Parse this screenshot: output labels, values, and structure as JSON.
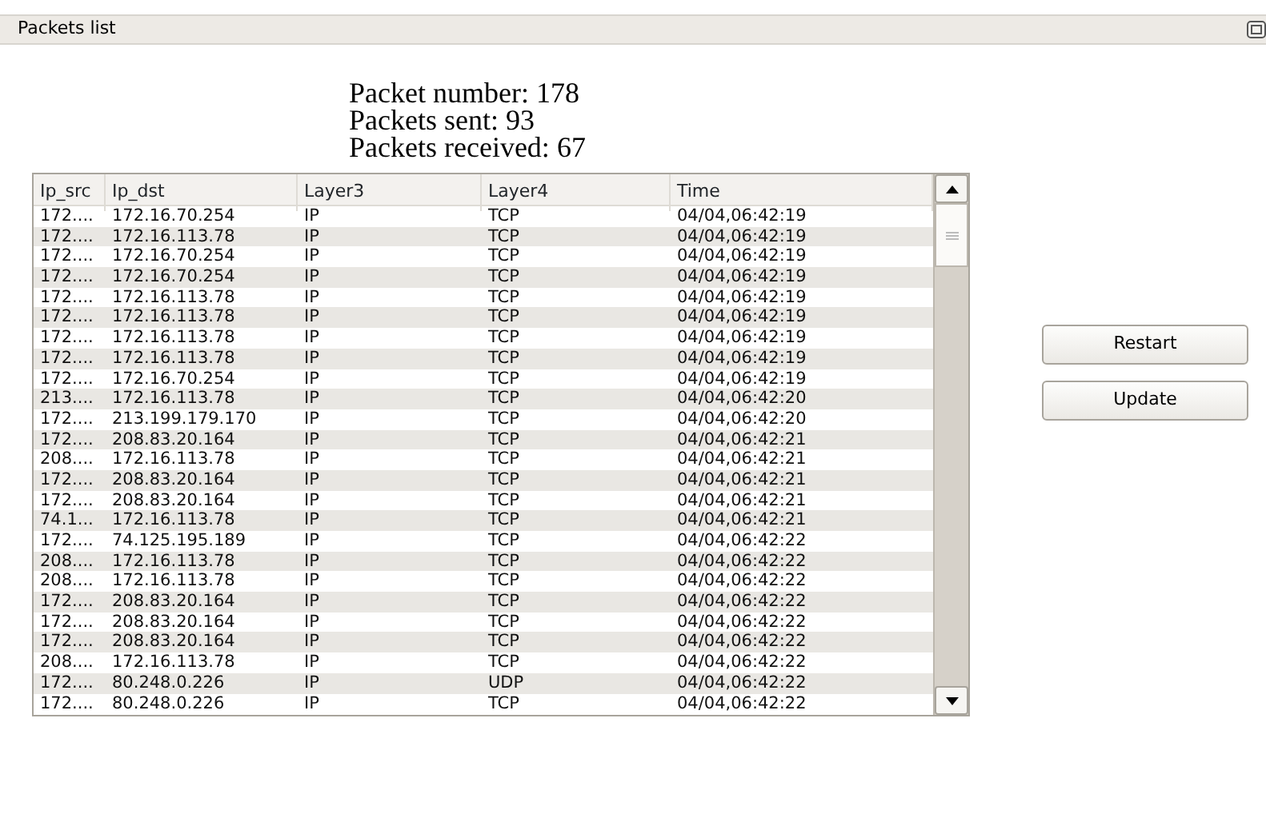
{
  "window": {
    "title": "Packets list"
  },
  "stats": [
    "Packet number: 178",
    "Packets sent: 93",
    "Packets received: 67"
  ],
  "table": {
    "columns": [
      "Ip_src",
      "Ip_dst",
      "Layer3",
      "Layer4",
      "Time"
    ],
    "rows": [
      [
        "172....",
        "172.16.70.254",
        "IP",
        "TCP",
        "04/04,06:42:19"
      ],
      [
        "172....",
        "172.16.113.78",
        "IP",
        "TCP",
        "04/04,06:42:19"
      ],
      [
        "172....",
        "172.16.70.254",
        "IP",
        "TCP",
        "04/04,06:42:19"
      ],
      [
        "172....",
        "172.16.70.254",
        "IP",
        "TCP",
        "04/04,06:42:19"
      ],
      [
        "172....",
        "172.16.113.78",
        "IP",
        "TCP",
        "04/04,06:42:19"
      ],
      [
        "172....",
        "172.16.113.78",
        "IP",
        "TCP",
        "04/04,06:42:19"
      ],
      [
        "172....",
        "172.16.113.78",
        "IP",
        "TCP",
        "04/04,06:42:19"
      ],
      [
        "172....",
        "172.16.113.78",
        "IP",
        "TCP",
        "04/04,06:42:19"
      ],
      [
        "172....",
        "172.16.70.254",
        "IP",
        "TCP",
        "04/04,06:42:19"
      ],
      [
        "213....",
        "172.16.113.78",
        "IP",
        "TCP",
        "04/04,06:42:20"
      ],
      [
        "172....",
        "213.199.179.170",
        "IP",
        "TCP",
        "04/04,06:42:20"
      ],
      [
        "172....",
        "208.83.20.164",
        "IP",
        "TCP",
        "04/04,06:42:21"
      ],
      [
        "208....",
        "172.16.113.78",
        "IP",
        "TCP",
        "04/04,06:42:21"
      ],
      [
        "172....",
        "208.83.20.164",
        "IP",
        "TCP",
        "04/04,06:42:21"
      ],
      [
        "172....",
        "208.83.20.164",
        "IP",
        "TCP",
        "04/04,06:42:21"
      ],
      [
        "74.1...",
        "172.16.113.78",
        "IP",
        "TCP",
        "04/04,06:42:21"
      ],
      [
        "172....",
        "74.125.195.189",
        "IP",
        "TCP",
        "04/04,06:42:22"
      ],
      [
        "208....",
        "172.16.113.78",
        "IP",
        "TCP",
        "04/04,06:42:22"
      ],
      [
        "208....",
        "172.16.113.78",
        "IP",
        "TCP",
        "04/04,06:42:22"
      ],
      [
        "172....",
        "208.83.20.164",
        "IP",
        "TCP",
        "04/04,06:42:22"
      ],
      [
        "172....",
        "208.83.20.164",
        "IP",
        "TCP",
        "04/04,06:42:22"
      ],
      [
        "172....",
        "208.83.20.164",
        "IP",
        "TCP",
        "04/04,06:42:22"
      ],
      [
        "208....",
        "172.16.113.78",
        "IP",
        "TCP",
        "04/04,06:42:22"
      ],
      [
        "172....",
        "80.248.0.226",
        "IP",
        "UDP",
        "04/04,06:42:22"
      ],
      [
        "172....",
        "80.248.0.226",
        "IP",
        "TCP",
        "04/04,06:42:22"
      ]
    ]
  },
  "buttons": [
    "Restart",
    "Update"
  ]
}
